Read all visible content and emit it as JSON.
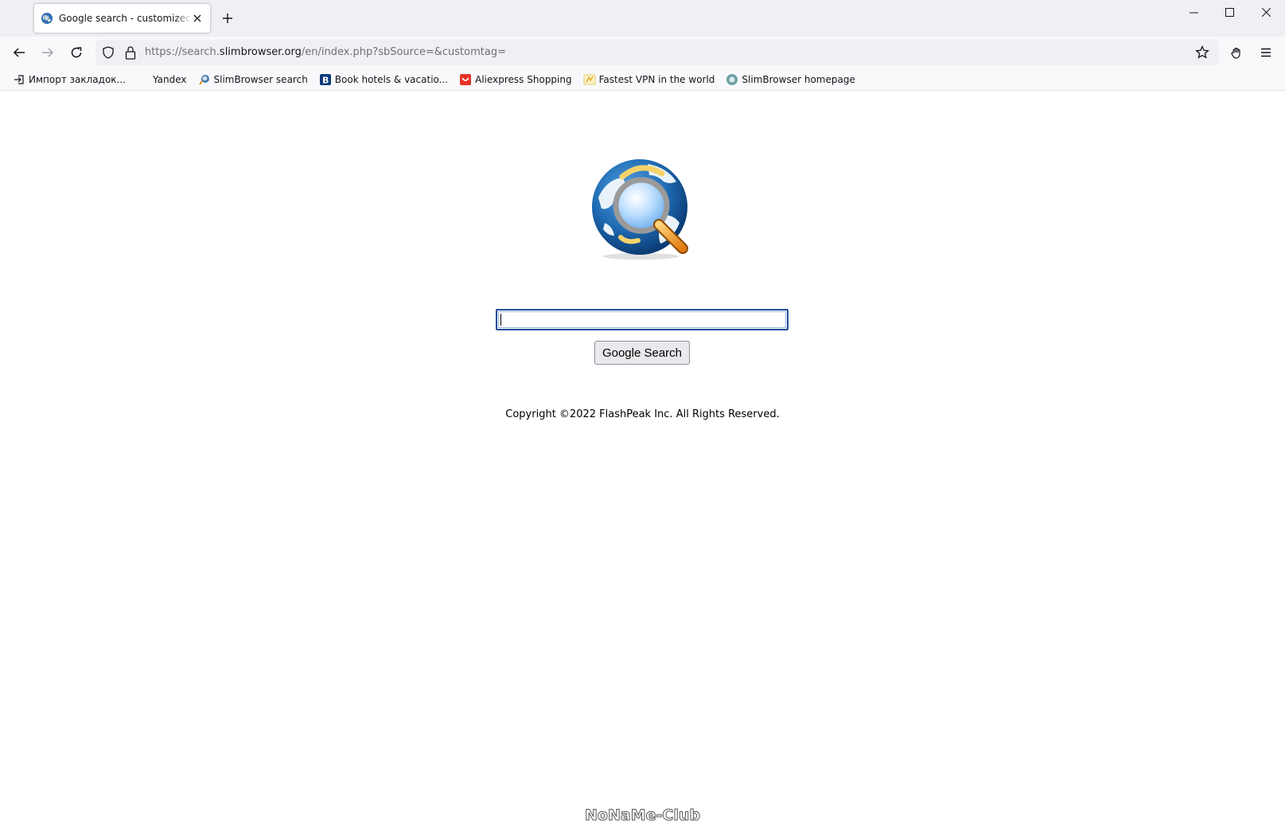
{
  "tab": {
    "title": "Google search - customized by SlimBrowser",
    "favicon": "globe-icon"
  },
  "window_controls": [
    "minimize-icon",
    "maximize-icon",
    "close-icon"
  ],
  "navbar": {
    "url_prefix": "https://search.",
    "url_host": "slimbrowser.org",
    "url_path": "/en/index.php?sbSource=&customtag="
  },
  "bookmarks": [
    {
      "label": "Импорт закладок...",
      "icon": "import-icon"
    },
    {
      "label": "Yandex",
      "icon": "none"
    },
    {
      "label": "SlimBrowser search",
      "icon": "magnifier-globe-icon"
    },
    {
      "label": "Book hotels & vacatio...",
      "icon": "booking-icon"
    },
    {
      "label": "Aliexpress Shopping",
      "icon": "aliexpress-icon"
    },
    {
      "label": "Fastest VPN in the world",
      "icon": "vpn-icon"
    },
    {
      "label": "SlimBrowser homepage",
      "icon": "globe-icon"
    }
  ],
  "page": {
    "search_button": "Google Search",
    "search_value": "",
    "copyright": "Copyright ©2022 FlashPeak Inc. All Rights Reserved.",
    "watermark": "NoNaMe-Club"
  },
  "colors": {
    "accent": "#1f4e9a",
    "chrome_bg": "#f0f0f4"
  }
}
